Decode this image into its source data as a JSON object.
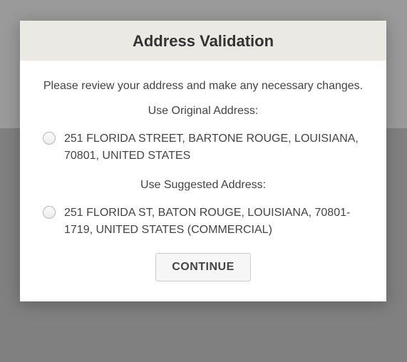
{
  "modal": {
    "title": "Address Validation",
    "instruction": "Please review your address and make any necessary changes.",
    "original_label": "Use Original Address:",
    "original_address": "251 FLORIDA STREET, BARTONE ROUGE, LOUISIANA, 70801, UNITED STATES",
    "suggested_label": "Use Suggested Address:",
    "suggested_address": "251 FLORIDA ST, BATON ROUGE, LOUISIANA, 70801-1719, UNITED STATES (COMMERCIAL)",
    "continue_button": "CONTINUE"
  }
}
